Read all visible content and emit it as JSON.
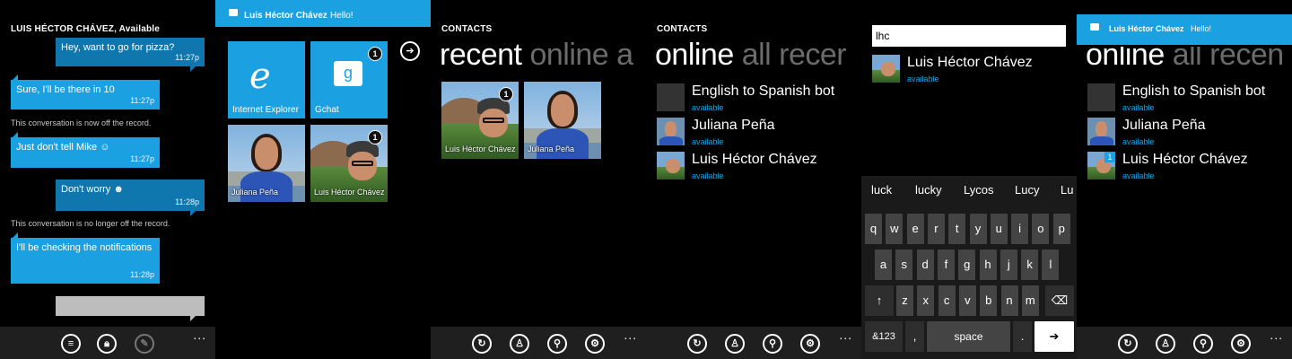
{
  "chat": {
    "title": "LUIS HÉCTOR CHÁVEZ, Available",
    "messages": [
      {
        "text": "Hey, want to go for pizza?",
        "time": "11:27p"
      },
      {
        "text": "Sure, I'll be there in 10",
        "time": "11:27p"
      },
      {
        "system": "This conversation is now off the record."
      },
      {
        "text": "Just don't tell Mike",
        "time": "11:27p"
      },
      {
        "text": "Don't worry",
        "time": "11:28p"
      },
      {
        "system": "This conversation is no longer off the record."
      },
      {
        "text": "I'll be checking the notifications",
        "time": "11:28p"
      }
    ],
    "emoticon_wink": "☺",
    "emoticon_grin": "☻"
  },
  "toast": {
    "name": "Luis Héctor Chávez",
    "message": "Hello!"
  },
  "start": {
    "tiles": [
      {
        "label": "Internet Explorer",
        "glyph": "e",
        "count": ""
      },
      {
        "label": "Gchat",
        "glyph": "g",
        "count": "1"
      },
      {
        "label": "Juliana Peña",
        "count": ""
      },
      {
        "label": "Luis Héctor Chávez",
        "count": "1"
      }
    ],
    "arrow": "➔"
  },
  "contacts": {
    "header": "CONTACTS",
    "pivot_recent": {
      "active": "recent",
      "rest": "online a"
    },
    "pivot_online": {
      "active": "online",
      "rest": "all recer"
    },
    "pivot_online_b": {
      "active": "online",
      "rest": "all recen"
    },
    "recent_tiles": [
      {
        "name": "Luis Héctor Chávez",
        "count": "1"
      },
      {
        "name": "Juliana Peña",
        "count": ""
      }
    ],
    "online": [
      {
        "name": "English to Spanish bot",
        "status": "available"
      },
      {
        "name": "Juliana Peña",
        "status": "available"
      },
      {
        "name": "Luis Héctor Chávez",
        "status": "available",
        "count": "1"
      }
    ]
  },
  "search": {
    "query": "lhc",
    "result": {
      "name": "Luis Héctor Chávez",
      "status": "available"
    }
  },
  "keyboard": {
    "suggestions": [
      "luck",
      "lucky",
      "Lycos",
      "Lucy",
      "Lu"
    ],
    "row1": [
      "q",
      "w",
      "e",
      "r",
      "t",
      "y",
      "u",
      "i",
      "o",
      "p"
    ],
    "row2": [
      "a",
      "s",
      "d",
      "f",
      "g",
      "h",
      "j",
      "k",
      "l"
    ],
    "row3": [
      "z",
      "x",
      "c",
      "v",
      "b",
      "n",
      "m"
    ],
    "shift": "↑",
    "backspace": "⌫",
    "sym": "&123",
    "comma": ",",
    "space": "space",
    "period": ".",
    "enter": "➔"
  },
  "appbar": {
    "more": "...",
    "chat_icons": [
      "chat-icon",
      "lock-icon",
      "pin-icon"
    ],
    "contacts_icons": [
      "refresh-icon",
      "add-contact-icon",
      "search-icon",
      "settings-icon"
    ]
  }
}
